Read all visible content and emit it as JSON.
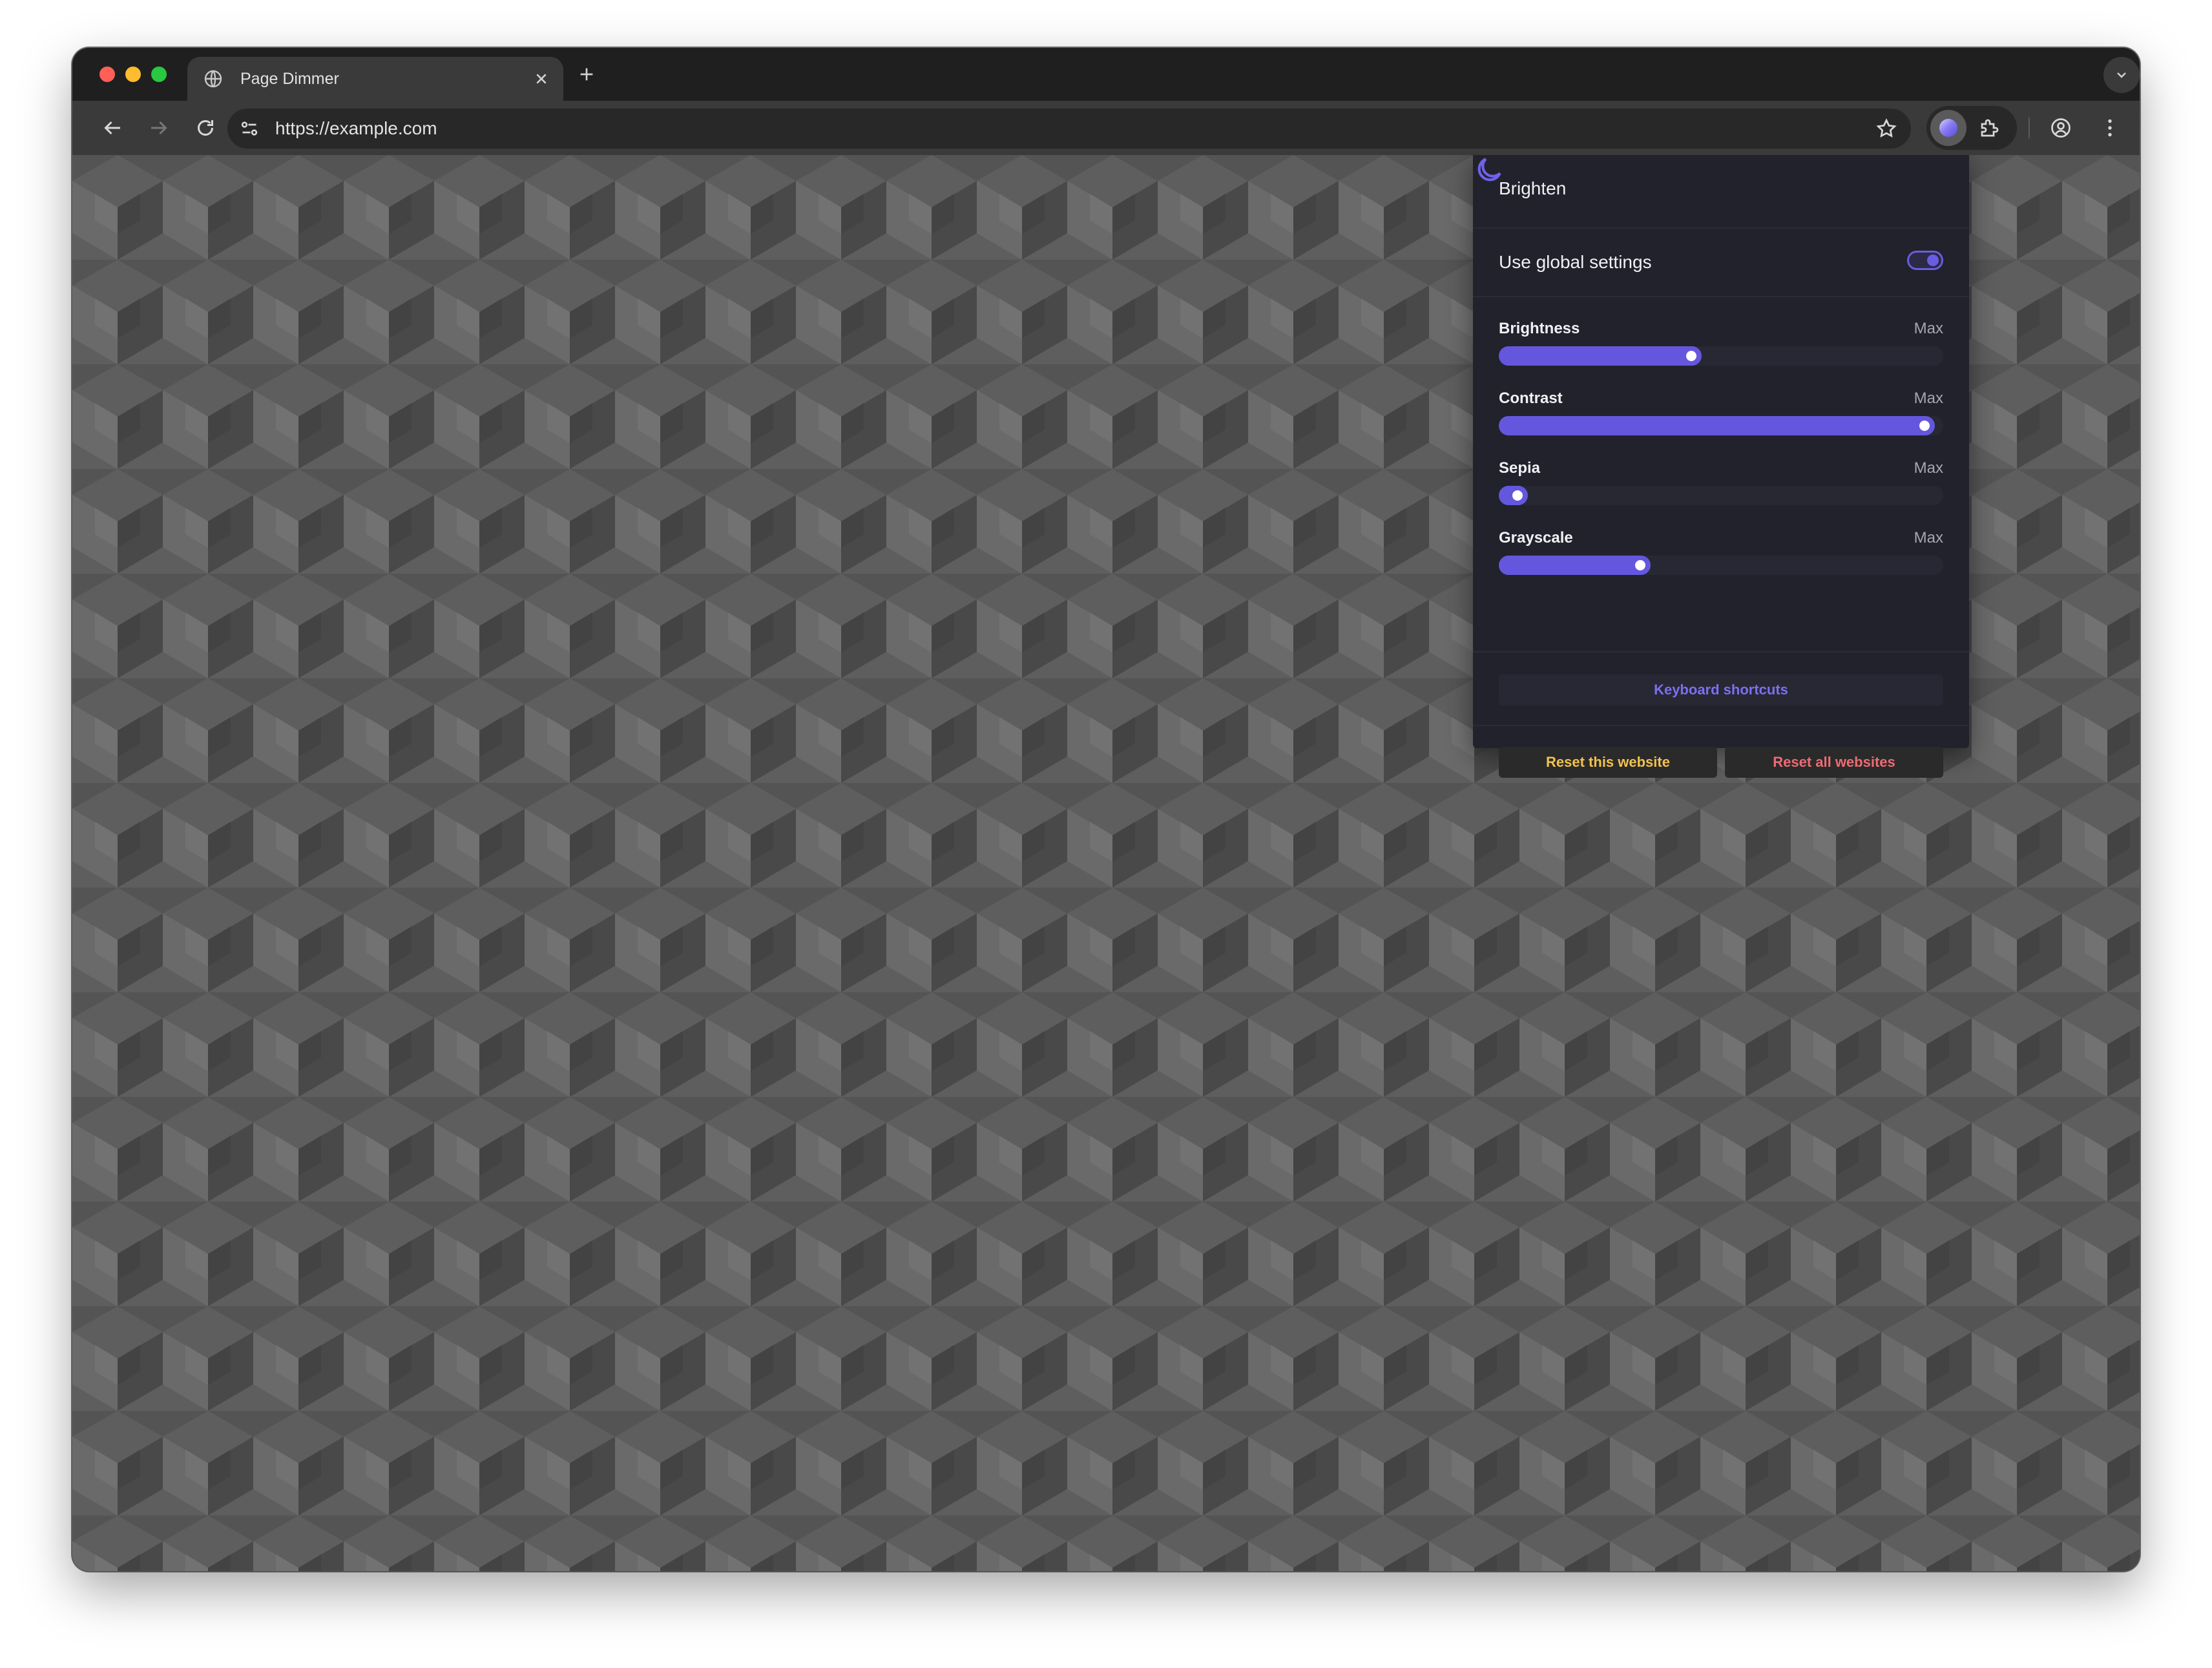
{
  "browser": {
    "tab": {
      "title": "Page Dimmer"
    },
    "address_bar": {
      "url": "https://example.com"
    }
  },
  "popup": {
    "title": "Brighten",
    "global_settings_label": "Use global settings",
    "global_settings_enabled": true,
    "sliders": [
      {
        "label": "Brightness",
        "max_label": "Max",
        "value_fraction": 0.43
      },
      {
        "label": "Contrast",
        "max_label": "Max",
        "value_fraction": 0.98
      },
      {
        "label": "Sepia",
        "max_label": "Max",
        "value_fraction": 0.02
      },
      {
        "label": "Grayscale",
        "max_label": "Max",
        "value_fraction": 0.31
      }
    ],
    "keyboard_shortcuts_label": "Keyboard shortcuts",
    "reset_site_label": "Reset this website",
    "reset_all_label": "Reset all websites"
  },
  "colors": {
    "accent": "#6457de",
    "reset_site": "#f2c14e",
    "reset_all": "#ef6b73",
    "page_pattern": [
      "#4a4a4a",
      "#545454",
      "#6a6a6a"
    ]
  },
  "icons": {
    "tab_favicon": "globe-icon",
    "popup_header": "moon-icon",
    "extension_active": "page-dimmer-extension-icon"
  }
}
